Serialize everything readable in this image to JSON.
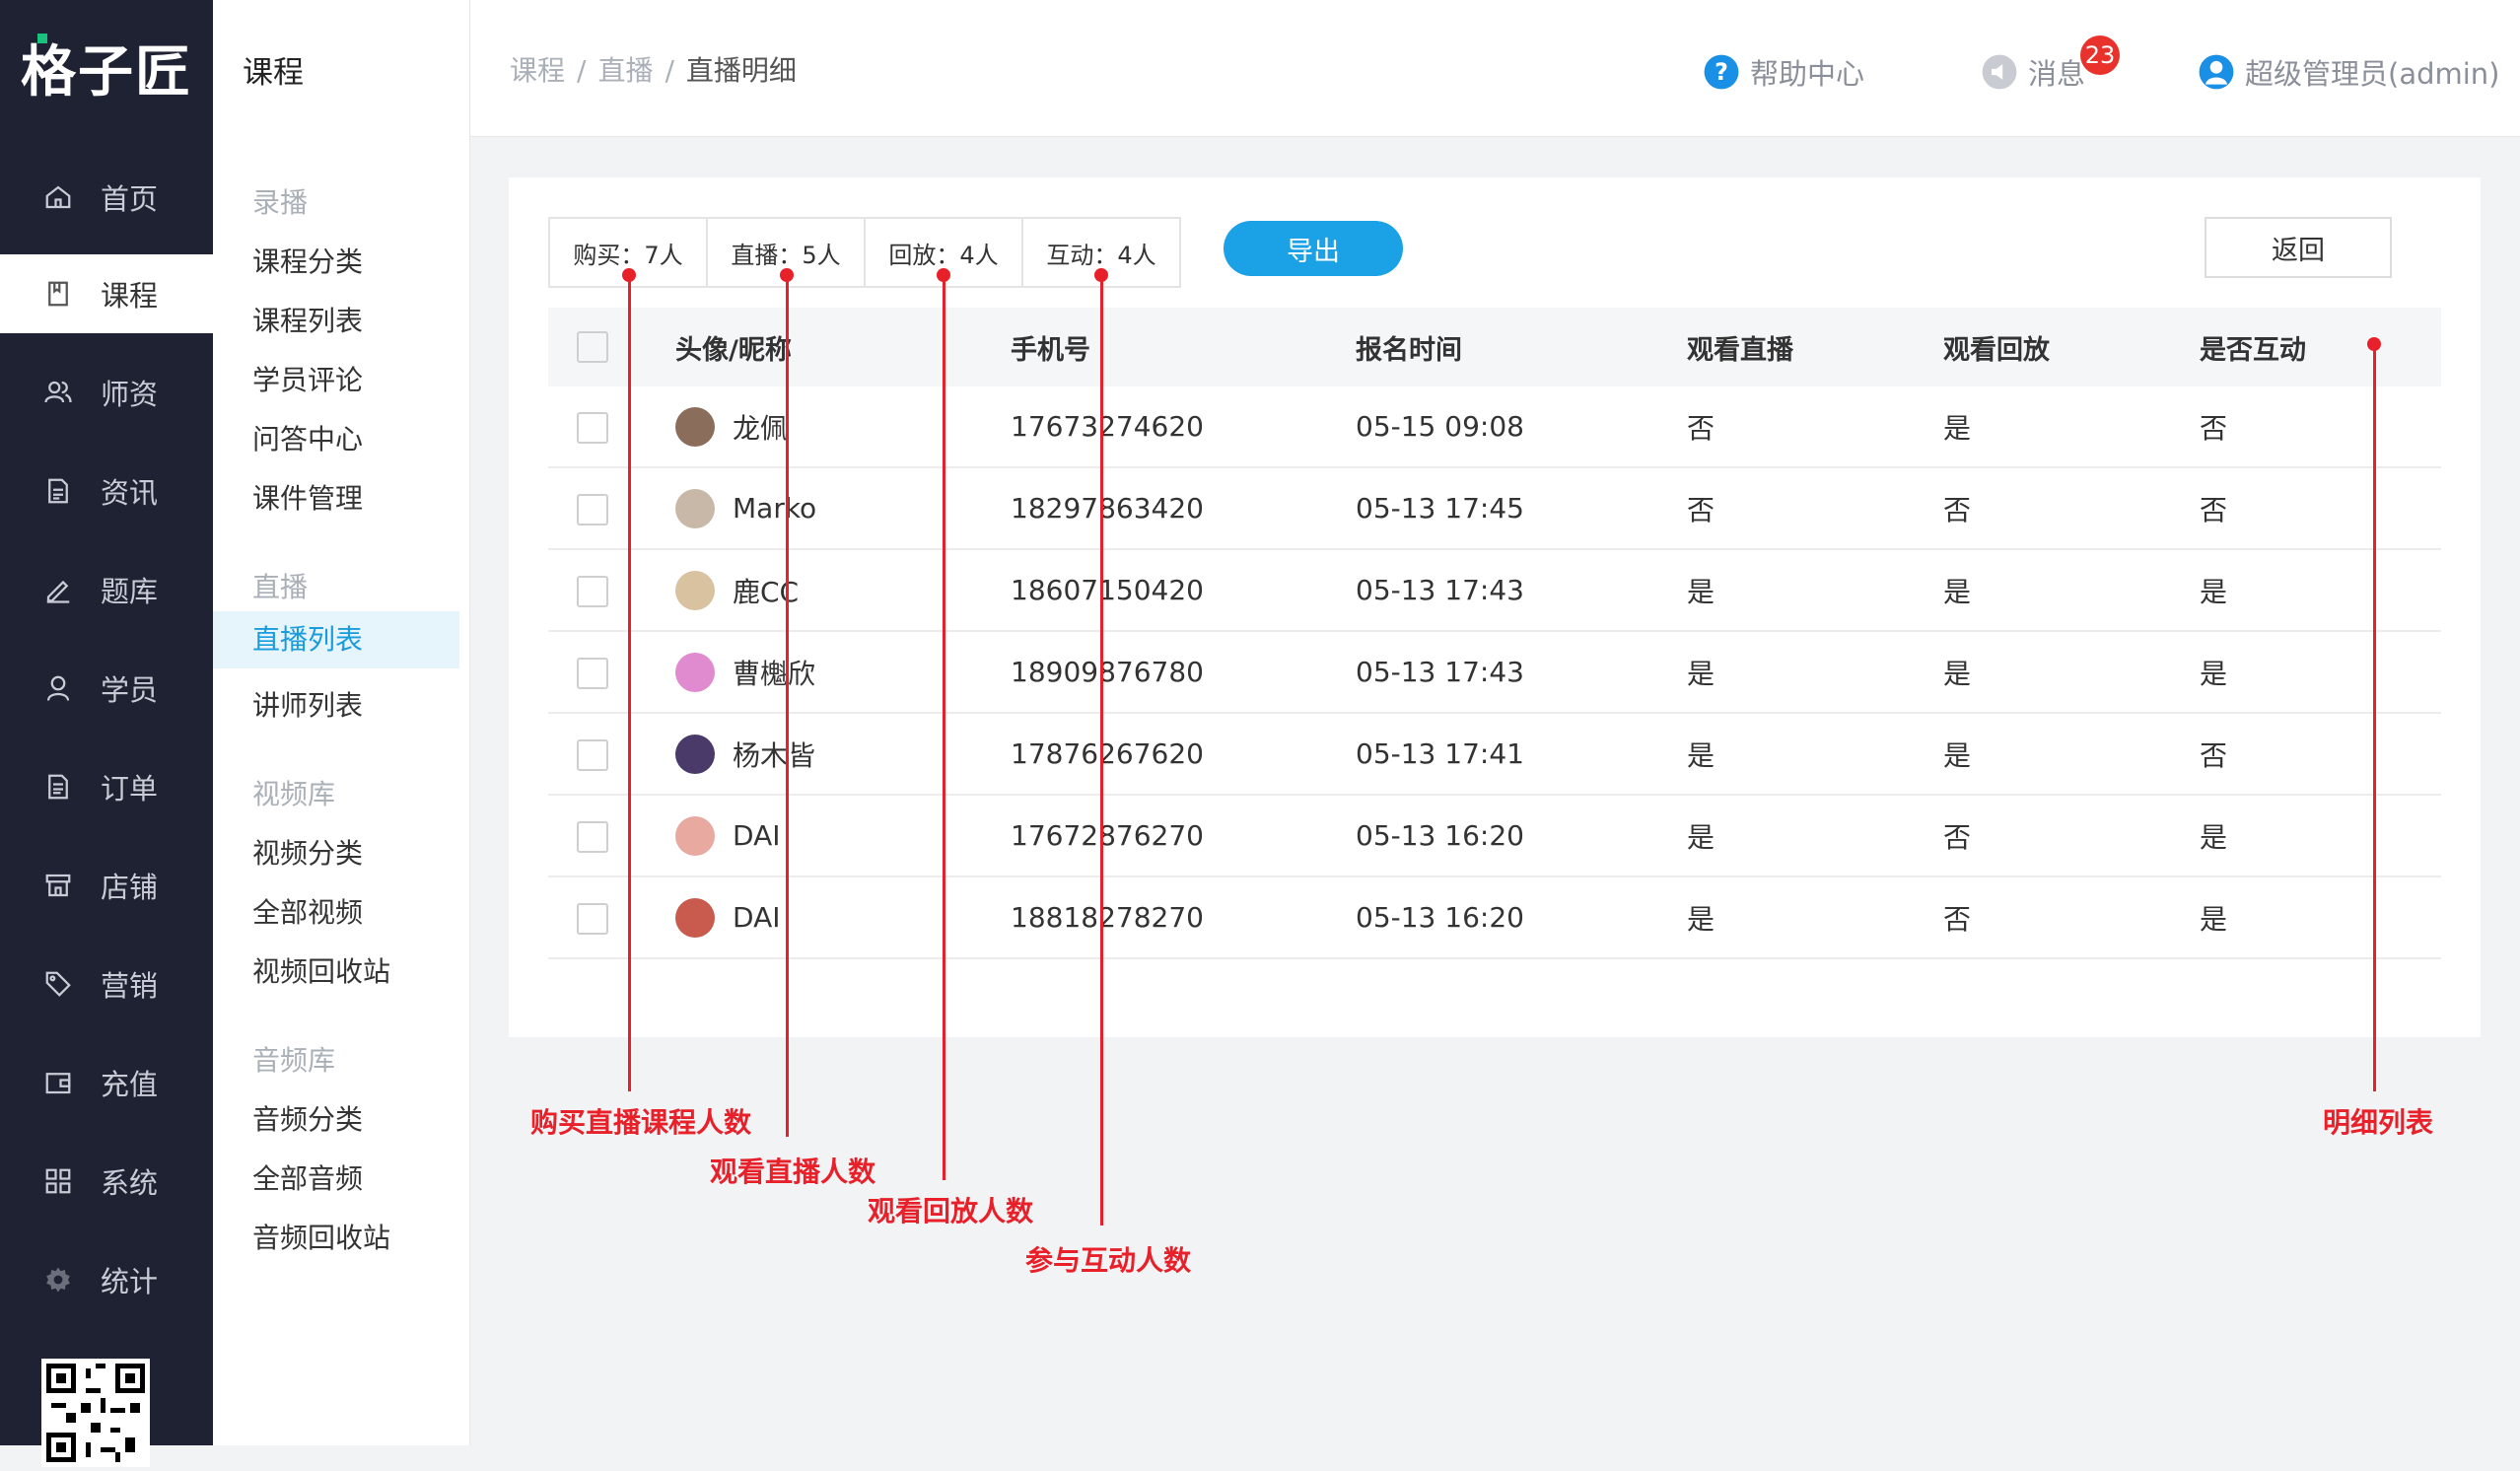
{
  "logo": "格子匠",
  "nav": {
    "items": [
      {
        "label": "首页",
        "icon": "home-icon"
      },
      {
        "label": "课程",
        "icon": "book-icon",
        "active": true
      },
      {
        "label": "师资",
        "icon": "users-icon"
      },
      {
        "label": "资讯",
        "icon": "document-icon"
      },
      {
        "label": "题库",
        "icon": "pen-icon"
      },
      {
        "label": "学员",
        "icon": "user-icon"
      },
      {
        "label": "订单",
        "icon": "order-icon"
      },
      {
        "label": "店铺",
        "icon": "shop-icon"
      },
      {
        "label": "营销",
        "icon": "tag-icon"
      },
      {
        "label": "充值",
        "icon": "wallet-icon"
      },
      {
        "label": "系统",
        "icon": "grid-icon"
      },
      {
        "label": "统计",
        "icon": "gear-icon"
      }
    ]
  },
  "submenu": {
    "title": "课程",
    "groups": [
      {
        "label": "录播",
        "items": [
          "课程分类",
          "课程列表",
          "学员评论",
          "问答中心",
          "课件管理"
        ]
      },
      {
        "label": "直播",
        "items": [
          "直播列表",
          "讲师列表"
        ]
      },
      {
        "label": "视频库",
        "items": [
          "视频分类",
          "全部视频",
          "视频回收站"
        ]
      },
      {
        "label": "音频库",
        "items": [
          "音频分类",
          "全部音频",
          "音频回收站"
        ]
      }
    ],
    "active_item": "直播列表"
  },
  "header": {
    "breadcrumb": [
      "课程",
      "直播",
      "直播明细"
    ],
    "help": "帮助中心",
    "messages": "消息",
    "message_count": "23",
    "user": "超级管理员(admin)"
  },
  "stats": [
    "购买：7人",
    "直播：5人",
    "回放：4人",
    "互动：4人"
  ],
  "export_label": "导出",
  "back_label": "返回",
  "table": {
    "columns": [
      "头像/昵称",
      "手机号",
      "报名时间",
      "观看直播",
      "观看回放",
      "是否互动"
    ],
    "rows": [
      {
        "name": "龙佩",
        "phone": "17673274620",
        "time": "05-15 09:08",
        "live": "否",
        "replay": "是",
        "interact": "否",
        "avatar_color": "#8b6d5c"
      },
      {
        "name": "Marko",
        "phone": "18297863420",
        "time": "05-13 17:45",
        "live": "否",
        "replay": "否",
        "interact": "否",
        "avatar_color": "#c7b8a8"
      },
      {
        "name": "鹿CC",
        "phone": "18607150420",
        "time": "05-13 17:43",
        "live": "是",
        "replay": "是",
        "interact": "是",
        "avatar_color": "#d9c2a0"
      },
      {
        "name": "曹櫆欣",
        "phone": "18909876780",
        "time": "05-13 17:43",
        "live": "是",
        "replay": "是",
        "interact": "是",
        "avatar_color": "#e08ad0"
      },
      {
        "name": "杨木皆",
        "phone": "17876267620",
        "time": "05-13 17:41",
        "live": "是",
        "replay": "是",
        "interact": "否",
        "avatar_color": "#4a3a6a"
      },
      {
        "name": "DAI",
        "phone": "17672876270",
        "time": "05-13 16:20",
        "live": "是",
        "replay": "否",
        "interact": "是",
        "avatar_color": "#e7a9a0"
      },
      {
        "name": "DAI",
        "phone": "18818278270",
        "time": "05-13 16:20",
        "live": "是",
        "replay": "否",
        "interact": "是",
        "avatar_color": "#c85a4e"
      }
    ]
  },
  "annotations": [
    "购买直播课程人数",
    "观看直播人数",
    "观看回放人数",
    "参与互动人数",
    "明细列表"
  ],
  "colors": {
    "accent": "#1aa1e6",
    "annotation": "#e8202a",
    "nav_bg": "#1f2233"
  }
}
